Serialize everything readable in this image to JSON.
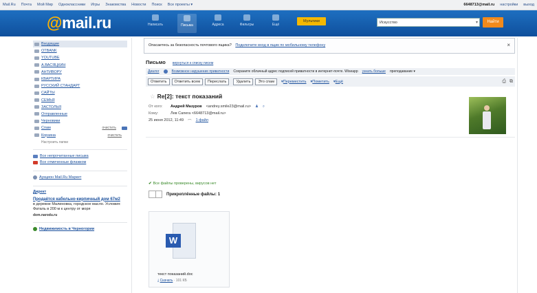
{
  "topbar": {
    "links": [
      "Mail.Ru",
      "Почта",
      "Мой Мир",
      "Одноклассники",
      "Игры",
      "Знакомства",
      "Новости",
      "Поиск",
      "Все проекты ▾"
    ],
    "email": "6648713@mail.ru",
    "settings": "настройки",
    "logout": "выход"
  },
  "header": {
    "logo_at": "@",
    "logo_text": "mail.ru",
    "nav": [
      {
        "label": "Написать",
        "icon": "pencil-icon"
      },
      {
        "label": "Письма",
        "icon": "envelope-icon"
      },
      {
        "label": "Адреса",
        "icon": "contacts-icon"
      },
      {
        "label": "Фильтры",
        "icon": "filter-icon"
      },
      {
        "label": "Ещё",
        "icon": "more-icon"
      }
    ],
    "theme_button": "Мультики",
    "search_value": "Искусство",
    "search_button": "Найти"
  },
  "sidebar": {
    "folders": [
      {
        "label": "Входящие",
        "selected": true
      },
      {
        "label": "OTBANK"
      },
      {
        "label": "YOUTUBE"
      },
      {
        "label": "А.ВАСЯЦКИН"
      },
      {
        "label": "АНТИВОРУ"
      },
      {
        "label": "КВАРТИРА"
      },
      {
        "label": "РУССКИЙ СТАНДАРТ"
      },
      {
        "label": "САЙТЫ"
      },
      {
        "label": "СЕМЬЯ"
      },
      {
        "label": "ЗАСТОЛЬЯ"
      },
      {
        "label": "Отправленные"
      },
      {
        "label": "Черновики"
      },
      {
        "label": "Спам",
        "count": "очистить",
        "badge": true
      },
      {
        "label": "Корзина",
        "count": "очистить"
      }
    ],
    "settings_folders": "Настроить папки",
    "link_unread": "Все непрочитанные письма",
    "link_flagged": "Все отмеченные флажком",
    "link_about": "Аукцион Mail.Ru Маркет",
    "ad_header": "Директ",
    "ad_title": "Продаётся кабельно-кирпичный дом 67м2",
    "ad_text": "в деревне Малиновка, городское масло. Условия: Фаталь в 200 м к центру от моря",
    "ad_site": "dom.narodu.ru",
    "bottom_link": "Недвижимость в Черногории"
  },
  "main": {
    "notice_text": "Опасаетесь за безопасность почтового ящика?",
    "notice_link": "Подключите вход в ящик по мобильному телефону",
    "letter_title": "Письмо",
    "letter_title_link": "вернуться к списку писем",
    "security_label": "Диалог",
    "security_link": "Возможное нарушение приватности",
    "security_text": "Сохраните облачный адрес подписей приватности в интернет-почте. Wiseapp",
    "security_link2": "узнать больше",
    "security_more": "преподавание ▾",
    "toolbar": {
      "reply": "Ответить",
      "reply_all": "Ответить всем",
      "forward": "Переслать",
      "delete": "Удалить",
      "spam": "Это спам",
      "move": "Переместить",
      "mark": "Пометить",
      "more": "Ещё"
    },
    "subject": "Re[2]: текст показаний",
    "from_label": "От кого:",
    "from_name": "Андрей Мазуров",
    "from_email": "<andrey.smile23@mail.ru>",
    "to_label": "Кому:",
    "to_value": "Лев Сапега <6648713@mail.ru>",
    "date": "25 июня 2012, 11:49",
    "files_link": "1 файл",
    "scan_text": "Все файлы проверены, вирусов нет",
    "attachments_label": "Прикреплённые файлы: 1",
    "file_name": "текст показаний.doc",
    "file_download": "Скачать",
    "file_size": "· 101 КБ"
  }
}
